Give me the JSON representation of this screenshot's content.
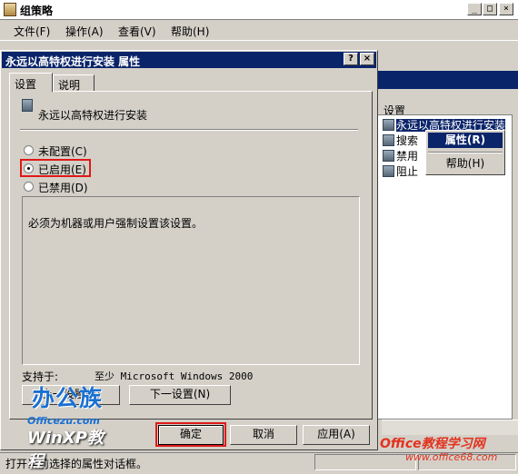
{
  "main_window": {
    "title": "组策略",
    "menu": [
      "文件(F)",
      "操作(A)",
      "查看(V)",
      "帮助(H)"
    ],
    "window_buttons": [
      "_",
      "□",
      "×"
    ]
  },
  "right_pane": {
    "column_header": "设置",
    "items": [
      "永远以高特权进行安装",
      "搜索",
      "禁用",
      "阻止"
    ]
  },
  "context_menu": {
    "items": [
      "属性(R)",
      "帮助(H)"
    ]
  },
  "status_bar": {
    "text": "打开当前选择的属性对话框。"
  },
  "dialog": {
    "title": "永远以高特权进行安装 属性",
    "title_buttons": [
      "?",
      "×"
    ],
    "tabs": [
      "设置",
      "说明"
    ],
    "policy_name": "永远以高特权进行安装",
    "radios": [
      {
        "label": "未配置(C)",
        "selected": false
      },
      {
        "label": "已启用(E)",
        "selected": true
      },
      {
        "label": "已禁用(D)",
        "selected": false
      }
    ],
    "description": "必须为机器或用户强制设置该设置。",
    "supported_label": "支持于:",
    "supported_value": "至少 Microsoft Windows 2000",
    "prev_button": "上一设置(P)",
    "next_button": "下一设置(N)",
    "ok_button": "确定",
    "cancel_button": "取消",
    "apply_button": "应用(A)"
  },
  "watermarks": {
    "brand_cn": "办公族",
    "brand_url": "Officezu.com",
    "winxp": "WinXP教程",
    "office68": "Office教程学习网",
    "office68_url": "www.office68.com"
  },
  "colors": {
    "titlebar": "#0a246a",
    "highlight_box": "#e01818",
    "face": "#d4d0c8"
  }
}
